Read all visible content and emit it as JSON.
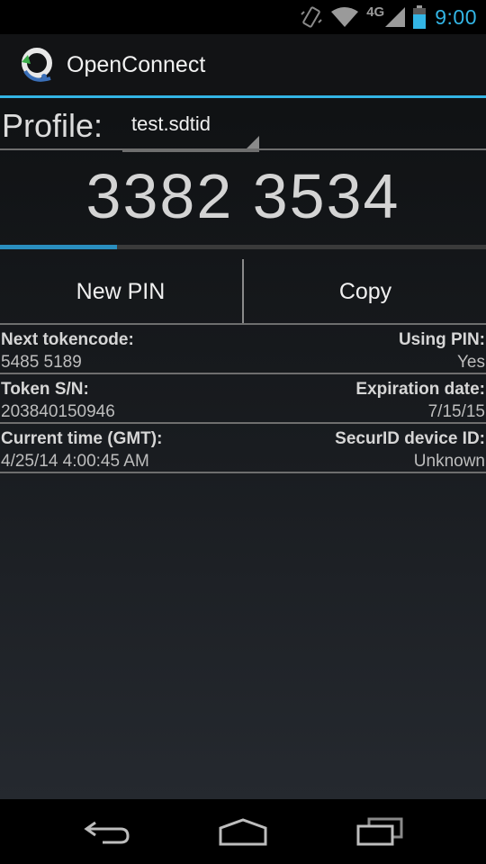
{
  "status_bar": {
    "time": "9:00",
    "network_label": "4G",
    "icons": [
      "vibrate-icon",
      "wifi-icon",
      "signal-icon",
      "battery-icon"
    ]
  },
  "app": {
    "title": "OpenConnect",
    "logo_icon": "openconnect-logo-icon",
    "accent_color": "#33b5e5"
  },
  "profile": {
    "label": "Profile:",
    "selected": "test.sdtid"
  },
  "token": {
    "code": "3382 3534",
    "progress": 0.24
  },
  "buttons": {
    "new_pin": "New PIN",
    "copy": "Copy"
  },
  "info": [
    {
      "left_label": "Next tokencode:",
      "left_value": "5485 5189",
      "right_label": "Using PIN:",
      "right_value": "Yes"
    },
    {
      "left_label": "Token S/N:",
      "left_value": "203840150946",
      "right_label": "Expiration date:",
      "right_value": "7/15/15"
    },
    {
      "left_label": "Current time (GMT):",
      "left_value": "4/25/14 4:00:45 AM",
      "right_label": "SecurID device ID:",
      "right_value": "Unknown"
    }
  ],
  "nav": {
    "icons": [
      "back-icon",
      "home-icon",
      "recent-apps-icon"
    ]
  }
}
